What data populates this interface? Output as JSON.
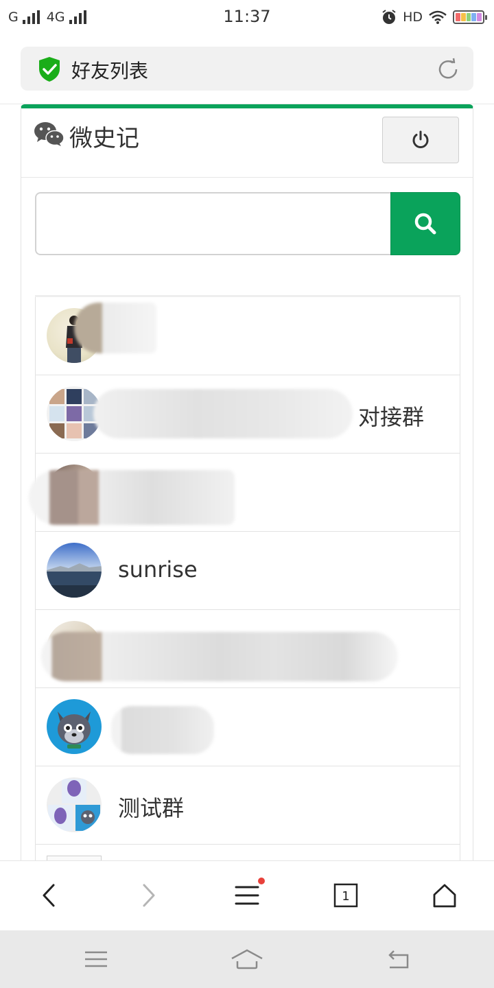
{
  "status_bar": {
    "carrier1": "G",
    "carrier2": "4G",
    "time": "11:37",
    "hd": "HD",
    "battery_colors": [
      "#f26b6b",
      "#f6c049",
      "#8ed27a",
      "#7fb0f2",
      "#d28be0"
    ]
  },
  "url_bar": {
    "title": "好友列表",
    "secure_icon": "shield-check-icon",
    "refresh_icon": "refresh-icon",
    "shield_color": "#1aad19"
  },
  "app": {
    "title": "微史记",
    "logo_icon": "wechat-icon",
    "power_icon": "power-icon",
    "accent_color": "#0aa35b"
  },
  "search": {
    "value": "",
    "placeholder": "",
    "button_icon": "search-icon"
  },
  "contacts": [
    {
      "name": "",
      "blurred": true
    },
    {
      "name": "对接群",
      "blurred": true
    },
    {
      "name": "",
      "blurred": true
    },
    {
      "name": "sunrise",
      "blurred": false
    },
    {
      "name": "",
      "blurred": true
    },
    {
      "name": "",
      "blurred": true
    },
    {
      "name": "测试群",
      "blurred": false
    },
    {
      "name": "",
      "blurred": false
    }
  ],
  "browser_nav": {
    "back_icon": "chevron-left-icon",
    "forward_icon": "chevron-right-icon",
    "menu_icon": "menu-icon",
    "tabs_count": "1",
    "home_icon": "home-icon"
  },
  "system_nav": {
    "menu_icon": "menu-icon",
    "home_icon": "home-icon",
    "back_icon": "back-icon"
  }
}
